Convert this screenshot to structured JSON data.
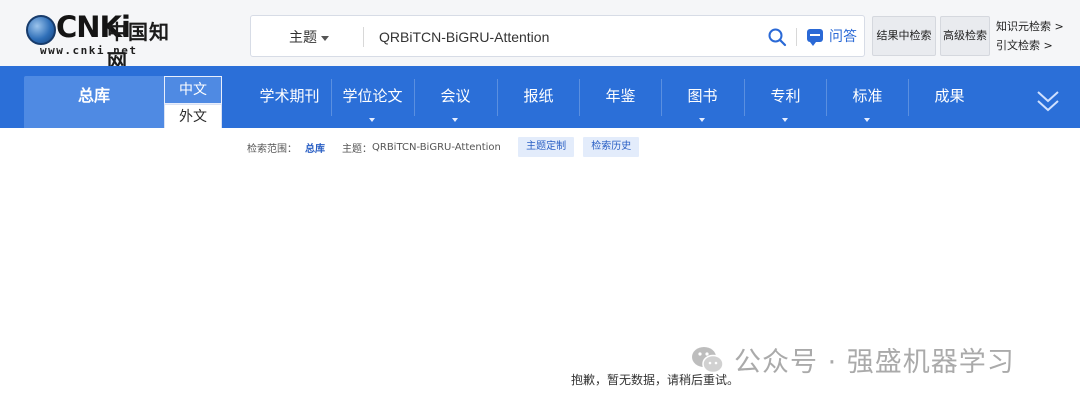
{
  "logo": {
    "brand": "CNKi",
    "name": "中国知网",
    "url": "www.cnki.net"
  },
  "search": {
    "field": "主题",
    "query": "QRBiTCN-BiGRU-Attention",
    "qa_label": "问答",
    "in_result_label": "结果中检索",
    "advanced_label": "高级检索",
    "links": [
      "知识元检索 >",
      "引文检索 >"
    ]
  },
  "nav": {
    "all_label": "总库",
    "lang_cn": "中文",
    "lang_foreign": "外文",
    "items": [
      "学术期刊",
      "学位论文",
      "会议",
      "报纸",
      "年鉴",
      "图书",
      "专利",
      "标准",
      "成果"
    ]
  },
  "scope": {
    "prefix": "检索范围：",
    "all": "总库",
    "query_prefix": "主题：",
    "query": "QRBiTCN-BiGRU-Attention",
    "customize": "主题定制",
    "history": "检索历史"
  },
  "empty_message": "抱歉，暂无数据，请稍后重试。",
  "watermark": "公众号 · 强盛机器学习",
  "colors": {
    "nav": "#2b6fd8",
    "nav_active": "#4f8ae3",
    "link": "#2a5fc4",
    "accent": "#2a69d6"
  },
  "icons": {
    "search": "search-icon",
    "qa": "chat-bubble-icon",
    "expand": "double-chevron-down-icon",
    "watermark": "wechat-icon"
  }
}
